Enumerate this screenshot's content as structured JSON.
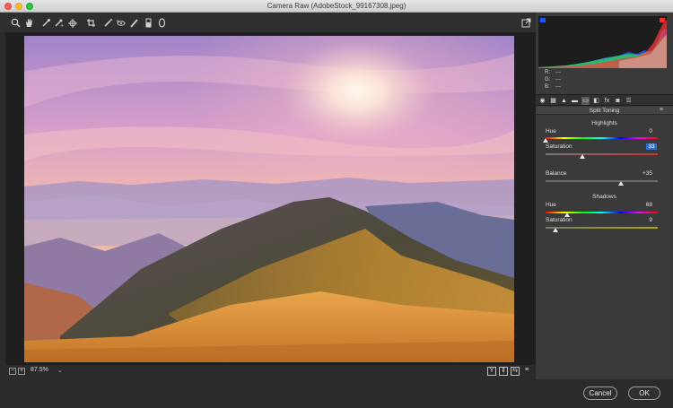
{
  "window": {
    "title": "Camera Raw (AdobeStock_99167308.jpeg)"
  },
  "toolbar": {
    "tools": [
      {
        "name": "zoom-tool",
        "glyph": "🔍"
      },
      {
        "name": "hand-tool",
        "glyph": "✋"
      },
      {
        "name": "white-balance-tool",
        "glyph": "⟋"
      },
      {
        "name": "color-sampler-tool",
        "glyph": "⟋"
      },
      {
        "name": "targeted-adjustment-tool",
        "glyph": "⊕"
      },
      {
        "name": "crop-tool",
        "glyph": "⌗"
      },
      {
        "name": "spot-removal-tool",
        "glyph": "⟋"
      },
      {
        "name": "red-eye-tool",
        "glyph": "+"
      },
      {
        "name": "adjustment-brush-tool",
        "glyph": "/"
      },
      {
        "name": "graduated-filter-tool",
        "glyph": "▮"
      },
      {
        "name": "radial-filter-tool",
        "glyph": "◯"
      }
    ],
    "open_preferences_glyph": "⇱"
  },
  "status": {
    "zoom_out": "−",
    "zoom_in": "+",
    "zoom_level": "87.5%",
    "zoom_dropdown": "⌄",
    "view_buttons": [
      "Y",
      "⇕",
      "⇆",
      "≡"
    ]
  },
  "histogram": {
    "r_label": "R:",
    "r_value": "---",
    "g_label": "G:",
    "g_value": "---",
    "b_label": "B:",
    "b_value": "---",
    "shadow_clip_color": "#1f57ff",
    "highlight_clip_color": "#ff2a2a"
  },
  "panel_tabs": [
    "◉",
    "▦",
    "▲",
    "▬",
    "▭",
    "◧",
    "fx",
    "◙",
    "☰"
  ],
  "split_toning": {
    "title": "Split Toning",
    "menu_glyph": "≡",
    "highlights": {
      "title": "Highlights",
      "hue_label": "Hue",
      "hue_value": "0",
      "hue_fraction": 0.0,
      "saturation_label": "Saturation",
      "saturation_value": "33",
      "saturation_fraction": 0.33
    },
    "balance": {
      "label": "Balance",
      "value": "+35",
      "fraction": 0.675
    },
    "shadows": {
      "title": "Shadows",
      "hue_label": "Hue",
      "hue_value": "68",
      "hue_fraction": 0.19,
      "saturation_label": "Saturation",
      "saturation_value": "9",
      "saturation_fraction": 0.09
    }
  },
  "footer": {
    "cancel_label": "Cancel",
    "ok_label": "OK"
  }
}
